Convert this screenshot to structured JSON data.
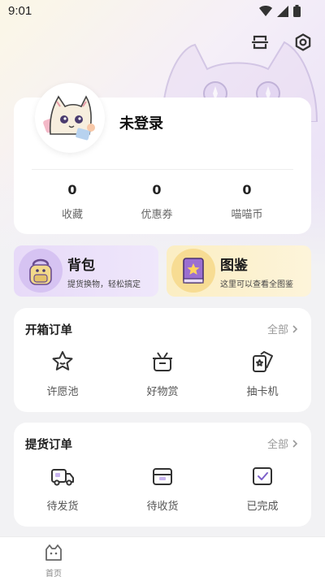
{
  "status_bar": {
    "time": "9:01"
  },
  "header": {
    "scan_icon": "scan-icon",
    "settings_icon": "settings-icon"
  },
  "profile": {
    "username": "未登录",
    "stats": [
      {
        "value": "0",
        "label": "收藏"
      },
      {
        "value": "0",
        "label": "优惠券"
      },
      {
        "value": "0",
        "label": "喵喵币"
      }
    ]
  },
  "promos": {
    "backpack": {
      "title": "背包",
      "subtitle": "提货换物，轻松搞定"
    },
    "catalog": {
      "title": "图鉴",
      "subtitle": "这里可以查看全图鉴"
    }
  },
  "unbox_orders": {
    "title": "开箱订单",
    "all_label": "全部",
    "items": [
      {
        "label": "许愿池",
        "icon": "star-icon"
      },
      {
        "label": "好物赏",
        "icon": "gift-box-icon"
      },
      {
        "label": "抽卡机",
        "icon": "card-icon"
      }
    ]
  },
  "pickup_orders": {
    "title": "提货订单",
    "all_label": "全部",
    "items": [
      {
        "label": "待发货",
        "icon": "truck-icon"
      },
      {
        "label": "待收货",
        "icon": "package-icon"
      },
      {
        "label": "已完成",
        "icon": "check-icon"
      }
    ]
  },
  "tabbar": {
    "home_label": "首页"
  },
  "colors": {
    "accent_purple": "#e7daf8",
    "accent_yellow": "#fbeec3",
    "icon_stroke": "#333333"
  }
}
